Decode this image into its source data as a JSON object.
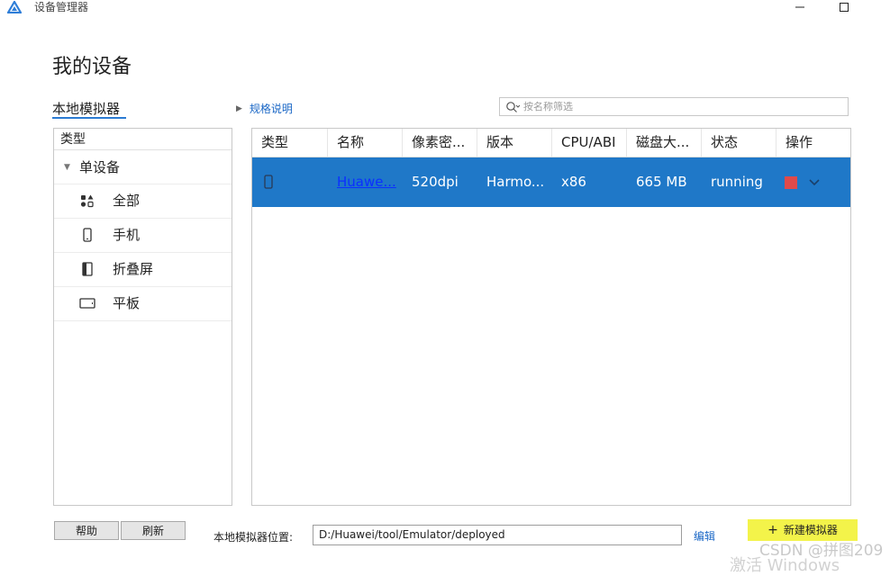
{
  "window": {
    "title": "设备管理器",
    "controls": [
      "minimize-icon",
      "maximize-icon"
    ]
  },
  "page": {
    "title": "我的设备",
    "tab_local": "本地模拟器",
    "spec_link": "规格说明",
    "search_placeholder": "按名称筛选"
  },
  "sidebar": {
    "header": "类型",
    "group": "单设备",
    "items": [
      {
        "label": "全部",
        "icon": "grid-shapes-icon"
      },
      {
        "label": "手机",
        "icon": "phone-icon"
      },
      {
        "label": "折叠屏",
        "icon": "foldable-icon"
      },
      {
        "label": "平板",
        "icon": "tablet-icon"
      }
    ]
  },
  "table": {
    "columns": [
      "类型",
      "名称",
      "像素密...",
      "版本",
      "CPU/ABI",
      "磁盘大...",
      "状态",
      "操作"
    ],
    "rows": [
      {
        "type_icon": "phone-icon",
        "name": "Huawe...",
        "density": "520dpi",
        "version": "Harmo...",
        "cpu": "x86",
        "disk": "665 MB",
        "status": "running",
        "action_icons": [
          "stop-icon",
          "chevron-down-icon"
        ]
      }
    ]
  },
  "footer": {
    "help": "帮助",
    "refresh": "刷新",
    "location_label": "本地模拟器位置:",
    "location_value": "D:/Huawei/tool/Emulator/deployed",
    "edit": "编辑",
    "new_emulator": "新建模拟器"
  },
  "watermark": {
    "csdn": "CSDN @拼图209",
    "activate": "激活 Windows"
  },
  "colors": {
    "accent": "#1f78c8",
    "link": "#1a67c6",
    "stop": "#e04a4a",
    "highlight": "#f3f34a"
  }
}
